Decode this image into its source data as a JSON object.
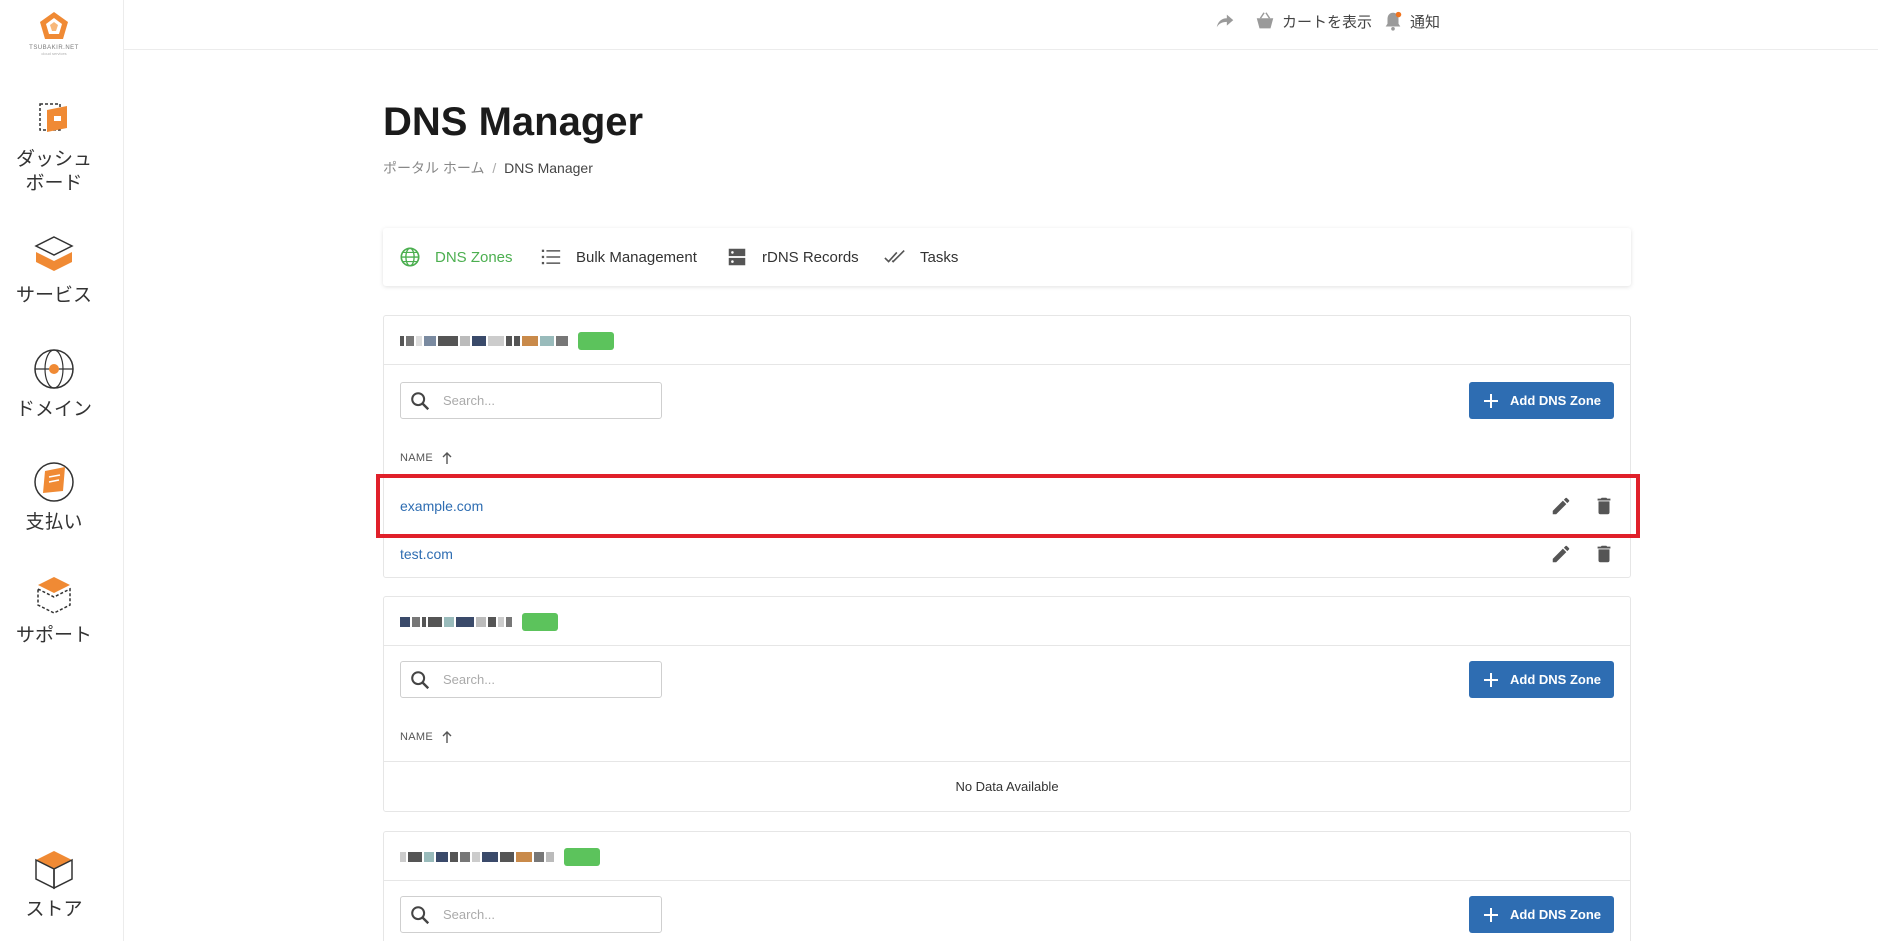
{
  "sidebar": {
    "logo_brand": "TSUBAKIR.NET",
    "logo_sub": "cloud services",
    "items": [
      {
        "label": "ダッシュ\nボード",
        "icon": "dashboard-icon"
      },
      {
        "label": "サービス",
        "icon": "services-icon"
      },
      {
        "label": "ドメイン",
        "icon": "domain-globe-icon"
      },
      {
        "label": "支払い",
        "icon": "billing-icon"
      },
      {
        "label": "サポート",
        "icon": "support-icon"
      },
      {
        "label": "ストア",
        "icon": "store-box-icon"
      }
    ]
  },
  "topbar": {
    "share_icon": "share-arrow-icon",
    "cart_label": "カートを表示",
    "notify_label": "通知"
  },
  "page": {
    "title": "DNS Manager",
    "breadcrumb_home": "ポータル ホーム",
    "breadcrumb_sep": "/",
    "breadcrumb_current": "DNS Manager"
  },
  "tabs": [
    {
      "label": "DNS Zones",
      "icon": "globe-icon",
      "active": true
    },
    {
      "label": "Bulk Management",
      "icon": "list-icon",
      "active": false
    },
    {
      "label": "rDNS Records",
      "icon": "server-icon",
      "active": false
    },
    {
      "label": "Tasks",
      "icon": "double-check-icon",
      "active": false
    }
  ],
  "colors": {
    "accent_green": "#4caf50",
    "primary_blue": "#2e6db2",
    "highlight_red": "#e0202a",
    "brand_orange": "#f08a34"
  },
  "cards": [
    {
      "search_placeholder": "Search...",
      "add_label": "Add DNS Zone",
      "col_name": "NAME",
      "rows": [
        "example.com",
        "test.com"
      ]
    },
    {
      "search_placeholder": "Search...",
      "add_label": "Add DNS Zone",
      "col_name": "NAME",
      "empty_text": "No Data Available"
    },
    {
      "search_placeholder": "Search...",
      "add_label": "Add DNS Zone"
    }
  ]
}
